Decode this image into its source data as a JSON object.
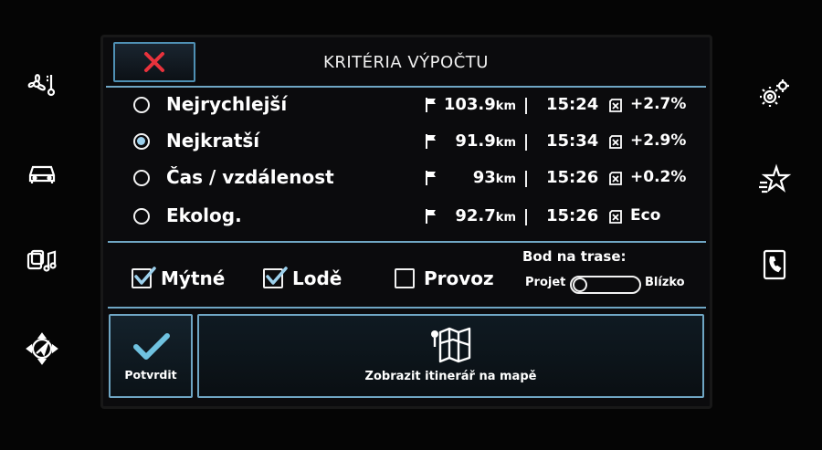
{
  "header": {
    "title": "KRITÉRIA VÝPOČTU"
  },
  "routes": [
    {
      "name": "Nejrychlejší",
      "distance": "103.9",
      "unit": "km",
      "time": "15:24",
      "consumption": "+2.7%",
      "selected": false
    },
    {
      "name": "Nejkratší",
      "distance": "91.9",
      "unit": "km",
      "time": "15:34",
      "consumption": "+2.9%",
      "selected": true
    },
    {
      "name": "Čas / vzdálenost",
      "distance": "93",
      "unit": "km",
      "time": "15:26",
      "consumption": "+0.2%",
      "selected": false
    },
    {
      "name": "Ekolog.",
      "distance": "92.7",
      "unit": "km",
      "time": "15:26",
      "consumption": "Eco",
      "selected": false
    }
  ],
  "options": [
    {
      "label": "Mýtné",
      "checked": true
    },
    {
      "label": "Lodě",
      "checked": true
    },
    {
      "label": "Provoz",
      "checked": false
    }
  ],
  "waypoint": {
    "label": "Bod na trase:",
    "left_label": "Projet",
    "right_label": "Blízko",
    "value": "Projet"
  },
  "footer": {
    "confirm_label": "Potvrdit",
    "map_label": "Zobrazit itinerář na mapě"
  },
  "colors": {
    "accent": "#6fa6c4",
    "close_icon": "#e8323c",
    "confirm_check": "#6fc2e0",
    "radio_selected": "#9cd0ec"
  },
  "icons": {
    "bezel_left": [
      "climate-icon",
      "car-icon",
      "media-icon",
      "navigation-icon"
    ],
    "bezel_right": [
      "settings-icon",
      "favorites-icon",
      "phone-icon"
    ]
  }
}
